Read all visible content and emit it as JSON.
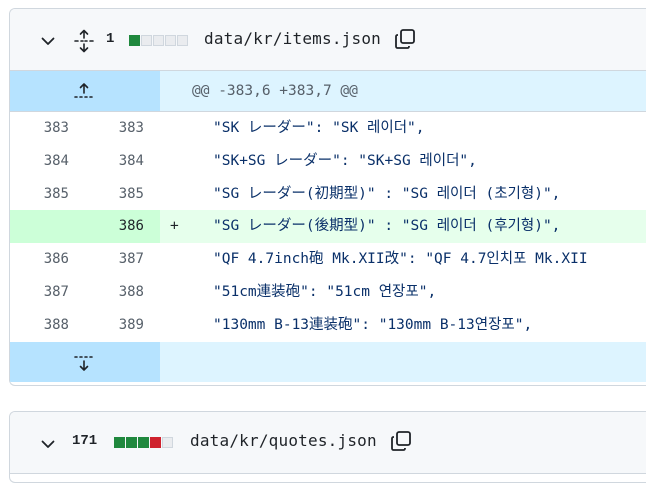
{
  "files": [
    {
      "count": "1",
      "blocks": [
        "add",
        "neu",
        "neu",
        "neu",
        "neu"
      ],
      "path": "data/kr/items.json",
      "hunk_header": "@@ -383,6 +383,7 @@",
      "lines": [
        {
          "old": "383",
          "new": "383",
          "marker": "",
          "type": "context",
          "code": "\"SK レーダー\": \"SK 레이더\","
        },
        {
          "old": "384",
          "new": "384",
          "marker": "",
          "type": "context",
          "code": "\"SK+SG レーダー\": \"SK+SG 레이더\","
        },
        {
          "old": "385",
          "new": "385",
          "marker": "",
          "type": "context",
          "code": "\"SG レーダー(初期型)\" : \"SG 레이더 (초기형)\","
        },
        {
          "old": "",
          "new": "386",
          "marker": "+",
          "type": "added",
          "code": "\"SG レーダー(後期型)\" : \"SG 레이더 (후기형)\","
        },
        {
          "old": "386",
          "new": "387",
          "marker": "",
          "type": "context",
          "code": "\"QF 4.7inch砲 Mk.XII改\": \"QF 4.7인치포 Mk.XII"
        },
        {
          "old": "387",
          "new": "388",
          "marker": "",
          "type": "context",
          "code": "\"51cm連装砲\": \"51cm 연장포\","
        },
        {
          "old": "388",
          "new": "389",
          "marker": "",
          "type": "context",
          "code": "\"130mm B-13連装砲\": \"130mm B-13연장포\","
        }
      ]
    },
    {
      "count": "171",
      "blocks": [
        "add",
        "add",
        "add",
        "del",
        "neu"
      ],
      "path": "data/kr/quotes.json"
    }
  ],
  "icons": {
    "collapse": "chevron-down-icon",
    "expand_all": "unfold-icon",
    "copy": "copy-icon",
    "expand_up": "expand-up-icon",
    "expand_down": "expand-down-icon"
  },
  "colors": {
    "added_bg": "#e6ffec",
    "added_gutter": "#ccffd8",
    "hunk_bg": "#ddf4ff",
    "hunk_gutter": "#b6e3ff",
    "string": "#0a3069",
    "add_block": "#1f883d",
    "del_block": "#cf222e"
  }
}
